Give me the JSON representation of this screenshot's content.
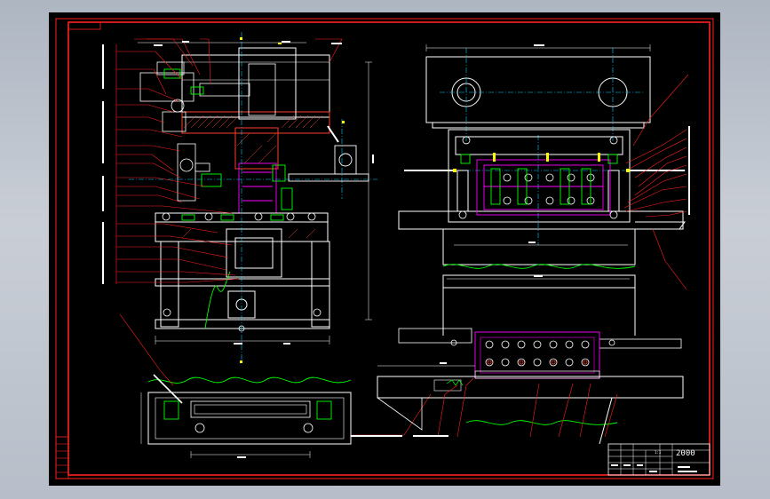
{
  "title_block": {
    "scale": "1:1",
    "code": "2000"
  },
  "colors": {
    "frame": "#ff2020",
    "part": "#ffffff",
    "hatch": "#ff3b2f",
    "center": "#00d0ff",
    "leader": "#ff2020",
    "section": "#00ff00",
    "punch": "#ff00ff",
    "accent": "#ffff00"
  }
}
